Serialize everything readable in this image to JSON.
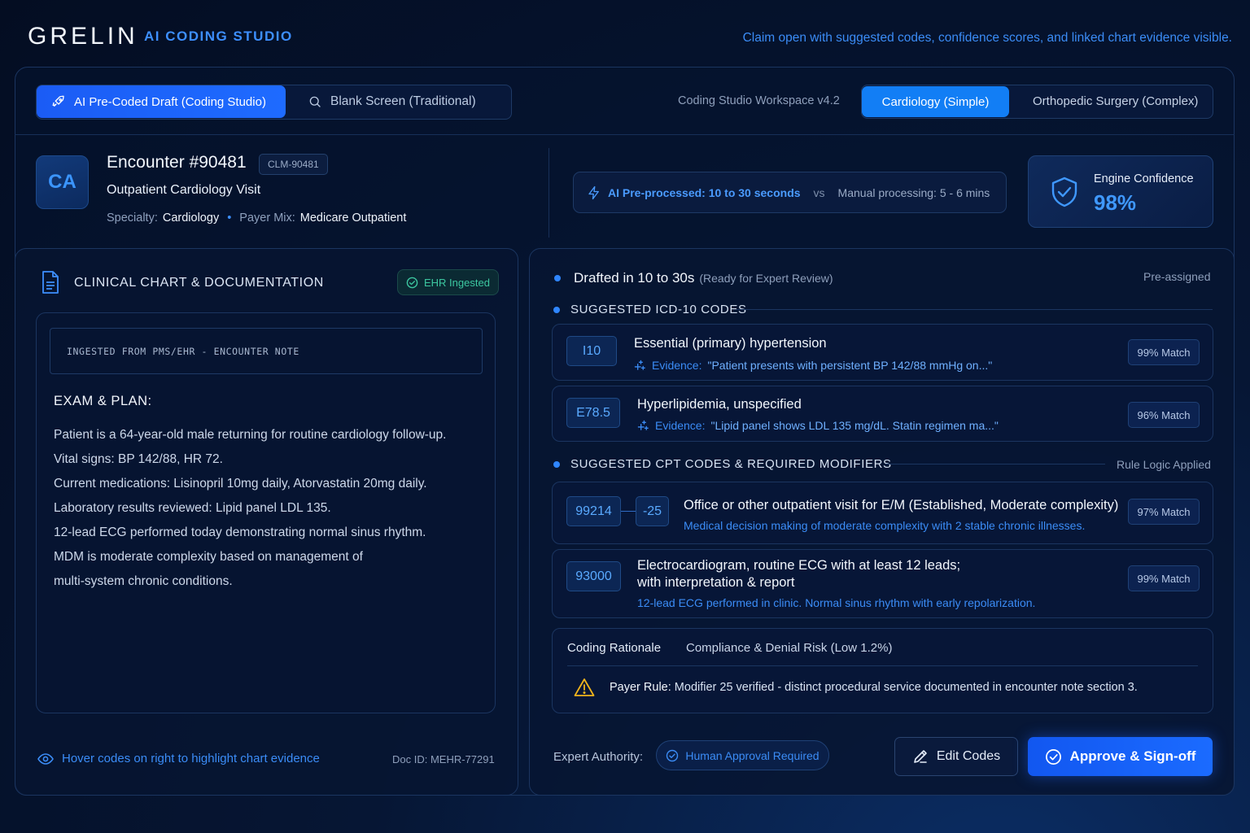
{
  "header": {
    "logo": "GRELIN",
    "product": "AI CODING STUDIO",
    "tagline": "Claim open with suggested codes, confidence scores, and linked chart evidence visible."
  },
  "modes": {
    "active": "AI Pre-Coded Draft (Coding Studio)",
    "inactive": "Blank Screen (Traditional)",
    "workspace": "Coding Studio Workspace v4.2"
  },
  "specialty_tabs": {
    "active": "Cardiology (Simple)",
    "inactive": "Orthopedic Surgery (Complex)"
  },
  "encounter": {
    "avatar": "CA",
    "title": "Encounter #90481",
    "claim_id": "CLM-90481",
    "visit_type": "Outpatient Cardiology Visit",
    "specialty_label": "Specialty:",
    "specialty": "Cardiology",
    "payer_label": "Payer Mix:",
    "payer": "Medicare Outpatient"
  },
  "processing": {
    "ai_text": "AI Pre-processed: 10 to 30 seconds",
    "vs": "vs",
    "manual_text": "Manual processing: 5 - 6 mins"
  },
  "confidence": {
    "label": "Engine Confidence",
    "value": "98%"
  },
  "chart": {
    "title": "CLINICAL CHART & DOCUMENTATION",
    "badge": "EHR Ingested",
    "note_header": "INGESTED FROM PMS/EHR - ENCOUNTER NOTE",
    "section_title": "EXAM & PLAN:",
    "lines": [
      "Patient is a 64-year-old male returning for routine cardiology follow-up.",
      "Vital signs: BP 142/88, HR 72.",
      "Current medications: Lisinopril 10mg daily, Atorvastatin 20mg daily.",
      "Laboratory results reviewed: Lipid panel LDL 135.",
      "12-lead ECG performed today demonstrating normal sinus rhythm.",
      "MDM is moderate complexity based on management of",
      "multi-system chronic conditions."
    ],
    "hint": "Hover codes on right to highlight chart evidence",
    "doc_id": "Doc ID:  MEHR-77291"
  },
  "draft": {
    "title": "Drafted in 10 to 30s",
    "subtitle": "(Ready for Expert Review)",
    "status": "Pre-assigned"
  },
  "icd": {
    "section_title": "SUGGESTED ICD-10 CODES",
    "items": [
      {
        "code": "I10",
        "title": "Essential (primary) hypertension",
        "evidence_label": "Evidence:",
        "evidence": "\"Patient presents with persistent BP 142/88 mmHg on...\"",
        "match": "99% Match"
      },
      {
        "code": "E78.5",
        "title": "Hyperlipidemia, unspecified",
        "evidence_label": "Evidence:",
        "evidence": "\"Lipid panel shows LDL 135 mg/dL. Statin regimen ma...\"",
        "match": "96% Match"
      }
    ]
  },
  "cpt": {
    "section_title": "SUGGESTED CPT CODES & REQUIRED MODIFIERS",
    "rule_label": "Rule Logic Applied",
    "items": [
      {
        "code": "99214",
        "modifier": "-25",
        "title": "Office or other outpatient visit for E/M (Established, Moderate complexity)",
        "desc": "Medical decision making of moderate complexity with 2 stable chronic illnesses.",
        "match": "97% Match"
      },
      {
        "code": "93000",
        "title_line1": "Electrocardiogram, routine ECG with at least 12 leads;",
        "title_line2": "with interpretation & report",
        "desc": "12-lead ECG performed in clinic. Normal sinus rhythm with early repolarization.",
        "match": "99% Match"
      }
    ]
  },
  "rationale": {
    "tab1": "Coding Rationale",
    "tab2": "Compliance & Denial Risk (Low 1.2%)",
    "rule_label": "Payer Rule:",
    "rule_text": "Modifier 25 verified - distinct procedural service documented in encounter note section 3."
  },
  "actions": {
    "authority_label": "Expert Authority:",
    "human_badge": "Human Approval Required",
    "edit": "Edit Codes",
    "approve": "Approve & Sign-off"
  }
}
